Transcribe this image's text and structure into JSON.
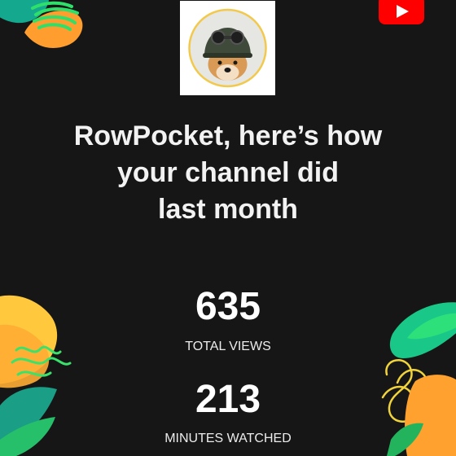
{
  "colors": {
    "background": "#161616",
    "text": "#ffffff",
    "youtube_red": "#ff0000",
    "avatar_ring": "#f2c94c",
    "accent_yellow": "#ffc83d",
    "accent_orange": "#ff9a2b",
    "accent_green": "#29d17a",
    "accent_teal": "#19b8a0"
  },
  "brand": {
    "logo_icon": "youtube-play-logo-icon"
  },
  "avatar": {
    "icon": "dog-with-goggles-avatar-icon"
  },
  "headline": {
    "line1": "RowPocket, here’s how",
    "line2": "your channel did",
    "line3": "last month"
  },
  "stats": [
    {
      "value": "635",
      "label": "TOTAL VIEWS"
    },
    {
      "value": "213",
      "label": "MINUTES WATCHED"
    }
  ]
}
